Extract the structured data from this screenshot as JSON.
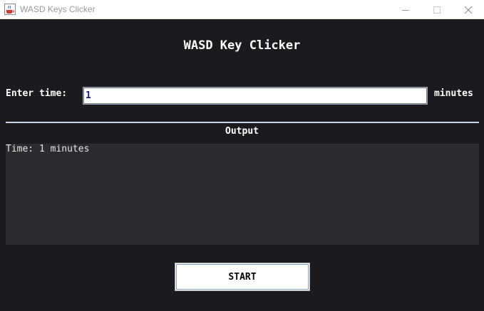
{
  "window": {
    "title": "WASD Keys Clicker",
    "app_icon": "java-cup-icon",
    "controls": [
      "minimize-icon",
      "maximize-icon",
      "close-icon"
    ]
  },
  "app": {
    "heading": "WASD Key Clicker"
  },
  "time_input": {
    "label": "Enter time:",
    "value": "1",
    "unit": "minutes"
  },
  "output": {
    "label": "Output",
    "text": "Time: 1 minutes"
  },
  "start_button": {
    "label": "START"
  },
  "colors": {
    "background": "#1b1b1f",
    "output_background": "#2c2c30",
    "separator": "#c9d3e8",
    "input_text": "#1a1aa0"
  }
}
